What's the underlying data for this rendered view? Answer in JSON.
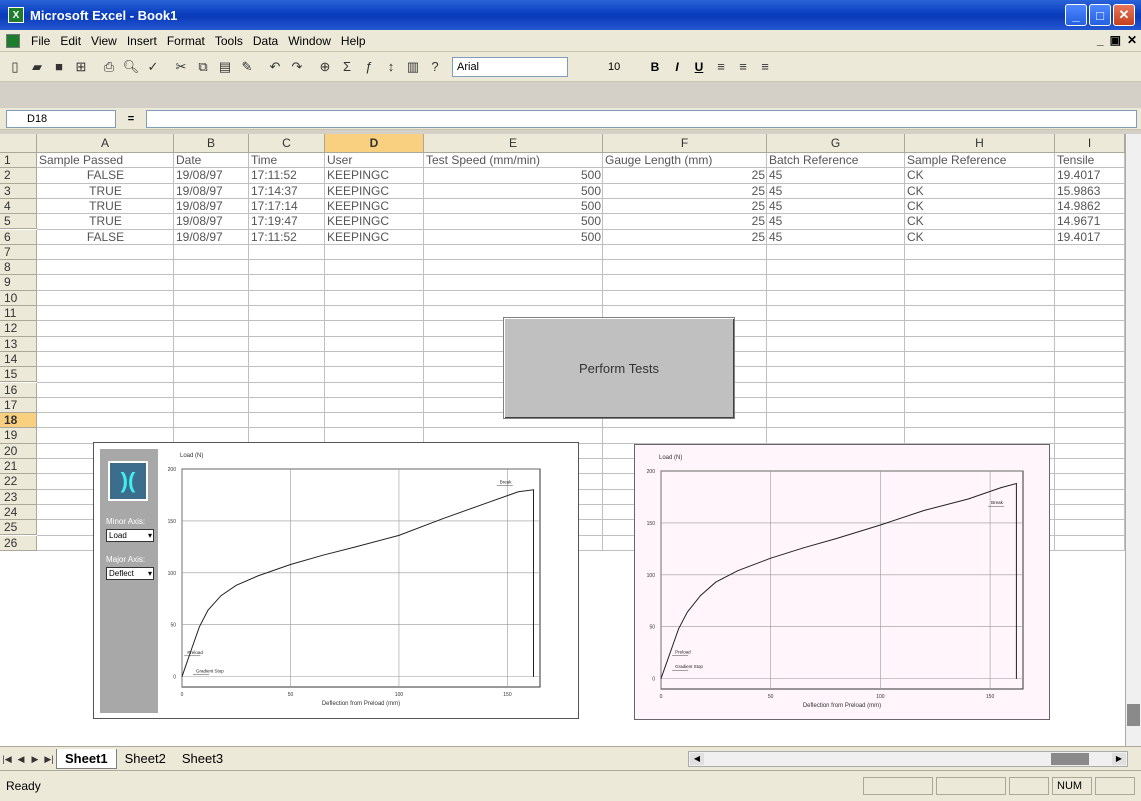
{
  "window": {
    "title": "Microsoft Excel - Book1"
  },
  "menu": [
    "File",
    "Edit",
    "View",
    "Insert",
    "Format",
    "Tools",
    "Data",
    "Window",
    "Help"
  ],
  "toolbar": {
    "font_name": "Arial",
    "font_size": "10",
    "bold": "B",
    "italic": "I",
    "underline": "U"
  },
  "formula_bar": {
    "name_box": "D18",
    "eq": "="
  },
  "columns": [
    "A",
    "B",
    "C",
    "D",
    "E",
    "F",
    "G",
    "H",
    "I"
  ],
  "rows": [
    "1",
    "2",
    "3",
    "4",
    "5",
    "6",
    "7",
    "8",
    "9",
    "10",
    "11",
    "12",
    "13",
    "14",
    "15",
    "16",
    "17",
    "18",
    "19",
    "20",
    "21",
    "22",
    "23",
    "24",
    "25",
    "26"
  ],
  "header_cells": [
    "Sample Passed",
    "Date",
    "Time",
    "User",
    "Test Speed (mm/min)",
    "Gauge Length (mm)",
    "Batch Reference",
    "Sample Reference",
    "Tensile"
  ],
  "data_rows": [
    [
      "FALSE",
      "19/08/97",
      "17:11:52",
      "KEEPINGC",
      "500",
      "25",
      "45",
      "CK",
      "19.4017"
    ],
    [
      "TRUE",
      "19/08/97",
      "17:14:37",
      "KEEPINGC",
      "500",
      "25",
      "45",
      "CK",
      "15.9863"
    ],
    [
      "TRUE",
      "19/08/97",
      "17:17:14",
      "KEEPINGC",
      "500",
      "25",
      "45",
      "CK",
      "14.9862"
    ],
    [
      "TRUE",
      "19/08/97",
      "17:19:47",
      "KEEPINGC",
      "500",
      "25",
      "45",
      "CK",
      "14.9671"
    ],
    [
      "FALSE",
      "19/08/97",
      "17:11:52",
      "KEEPINGC",
      "500",
      "25",
      "45",
      "CK",
      "19.4017"
    ]
  ],
  "perform_button": "Perform Tests",
  "chart1_sidebar": {
    "major_label": "Minor Axis:",
    "major_value": "Load",
    "minor_label": "Major Axis:",
    "minor_value": "Deflect"
  },
  "chart_data": [
    {
      "type": "line",
      "ylabel": "Load (N)",
      "xlabel": "Deflection from Preload (mm)",
      "y_ticks": [
        "200",
        "150",
        "100",
        "50",
        "0"
      ],
      "x_ticks": [
        "0",
        "50",
        "100",
        "150"
      ],
      "xlim": [
        0,
        165
      ],
      "ylim": [
        -10,
        200
      ],
      "annotations": [
        {
          "text": "Preload",
          "x": 2,
          "y": 22
        },
        {
          "text": "Gradient Stop",
          "x": 6,
          "y": 4
        },
        {
          "text": "Break",
          "x": 146,
          "y": 186
        }
      ],
      "series": [
        {
          "values_xy": [
            [
              0,
              0
            ],
            [
              2,
              12
            ],
            [
              5,
              30
            ],
            [
              8,
              48
            ],
            [
              12,
              64
            ],
            [
              18,
              78
            ],
            [
              25,
              88
            ],
            [
              35,
              97
            ],
            [
              50,
              108
            ],
            [
              65,
              117
            ],
            [
              80,
              125
            ],
            [
              100,
              136
            ],
            [
              120,
              152
            ],
            [
              140,
              167
            ],
            [
              155,
              178
            ],
            [
              162,
              180
            ],
            [
              162,
              0
            ]
          ]
        }
      ]
    },
    {
      "type": "line",
      "ylabel": "Load (N)",
      "xlabel": "Deflection from Preload (mm)",
      "y_ticks": [
        "200",
        "150",
        "100",
        "50",
        "0"
      ],
      "x_ticks": [
        "0",
        "50",
        "100",
        "150"
      ],
      "xlim": [
        0,
        165
      ],
      "ylim": [
        -10,
        200
      ],
      "annotations": [
        {
          "text": "Preload",
          "x": 6,
          "y": 24
        },
        {
          "text": "Gradient Stop",
          "x": 6,
          "y": 10
        },
        {
          "text": "Break",
          "x": 150,
          "y": 168
        }
      ],
      "series": [
        {
          "values_xy": [
            [
              0,
              0
            ],
            [
              2,
              12
            ],
            [
              5,
              30
            ],
            [
              8,
              48
            ],
            [
              12,
              64
            ],
            [
              18,
              80
            ],
            [
              25,
              93
            ],
            [
              35,
              104
            ],
            [
              50,
              116
            ],
            [
              65,
              126
            ],
            [
              80,
              135
            ],
            [
              100,
              148
            ],
            [
              120,
              162
            ],
            [
              140,
              173
            ],
            [
              155,
              184
            ],
            [
              162,
              188
            ],
            [
              162,
              0
            ]
          ]
        }
      ]
    }
  ],
  "sheet_tabs": [
    "Sheet1",
    "Sheet2",
    "Sheet3"
  ],
  "status": {
    "text": "Ready",
    "num": "NUM"
  }
}
